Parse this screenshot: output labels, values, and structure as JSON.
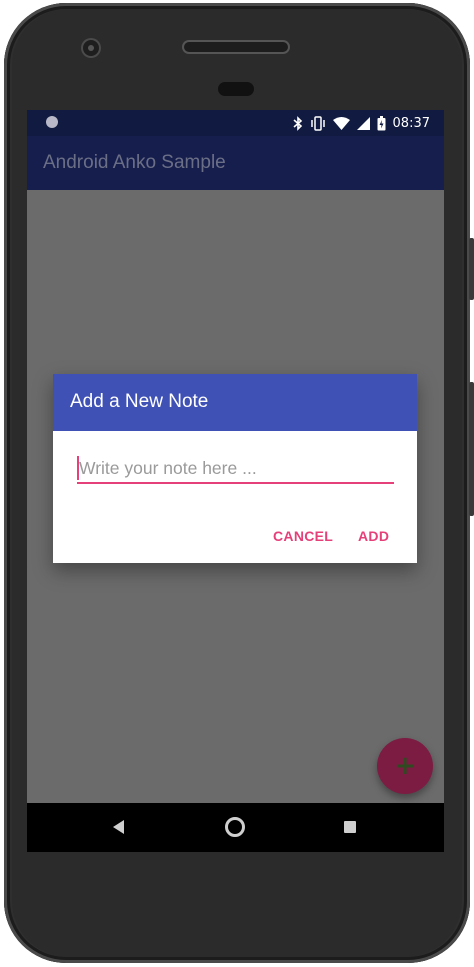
{
  "status_bar": {
    "time": "08:37",
    "icons": [
      "notification-dot-icon",
      "bluetooth-icon",
      "vibrate-icon",
      "wifi-icon",
      "signal-icon",
      "battery-icon"
    ]
  },
  "app_bar": {
    "title": "Android Anko Sample"
  },
  "dialog": {
    "title": "Add a New Note",
    "input_placeholder": "Write your note here ...",
    "input_value": "",
    "cancel_label": "CANCEL",
    "add_label": "ADD"
  },
  "fab": {
    "icon": "plus-icon",
    "symbol": "+"
  },
  "nav_bar": {
    "icons": [
      "back-icon",
      "home-icon",
      "recents-icon"
    ]
  },
  "colors": {
    "primary_dark": "#111a40",
    "dialog_header": "#3f51b5",
    "accent": "#e5407a",
    "fab": "#7c1c42",
    "scrim": "#6b6b6b"
  }
}
